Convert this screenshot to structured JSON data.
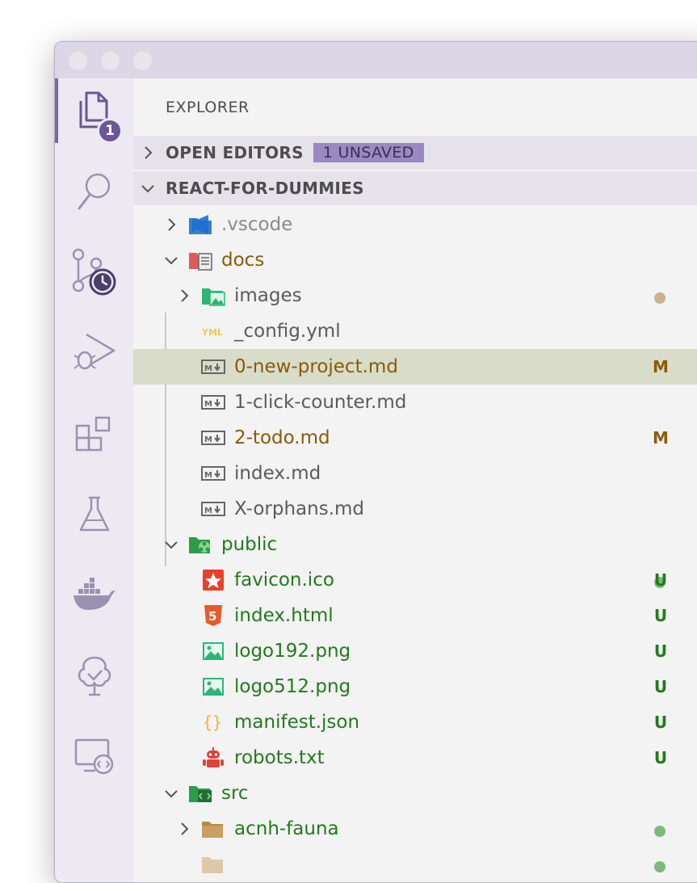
{
  "explorer": {
    "title": "EXPLORER",
    "activity_badge": "1",
    "open_editors": {
      "label": "OPEN EDITORS",
      "badge": "1 UNSAVED"
    },
    "project": {
      "label": "REACT-FOR-DUMMIES"
    }
  },
  "tree": [
    {
      "label": ".vscode",
      "status": "",
      "color": "#8a8a8a",
      "icon": "vscode-folder-icon"
    },
    {
      "label": "docs",
      "status": "dot",
      "color": "#8b5a08",
      "icon": "docs-folder-icon"
    },
    {
      "label": "images",
      "status": "",
      "color": "#5b5b5b",
      "icon": "images-folder-icon"
    },
    {
      "label": "_config.yml",
      "status": "",
      "color": "#5b5b5b",
      "icon": "yaml-icon"
    },
    {
      "label": "0-new-project.md",
      "status": "M",
      "color": "#8b5a08",
      "icon": "markdown-icon"
    },
    {
      "label": "1-click-counter.md",
      "status": "",
      "color": "#5b5b5b",
      "icon": "markdown-icon"
    },
    {
      "label": "2-todo.md",
      "status": "M",
      "color": "#8b5a08",
      "icon": "markdown-icon"
    },
    {
      "label": "index.md",
      "status": "",
      "color": "#5b5b5b",
      "icon": "markdown-icon"
    },
    {
      "label": "X-orphans.md",
      "status": "",
      "color": "#5b5b5b",
      "icon": "markdown-icon"
    },
    {
      "label": "public",
      "status": "dot",
      "color": "#237a1c",
      "icon": "public-folder-icon"
    },
    {
      "label": "favicon.ico",
      "status": "U",
      "color": "#237a1c",
      "icon": "favicon-icon"
    },
    {
      "label": "index.html",
      "status": "U",
      "color": "#237a1c",
      "icon": "html5-icon"
    },
    {
      "label": "logo192.png",
      "status": "U",
      "color": "#237a1c",
      "icon": "image-icon"
    },
    {
      "label": "logo512.png",
      "status": "U",
      "color": "#237a1c",
      "icon": "image-icon"
    },
    {
      "label": "manifest.json",
      "status": "U",
      "color": "#237a1c",
      "icon": "json-icon"
    },
    {
      "label": "robots.txt",
      "status": "U",
      "color": "#237a1c",
      "icon": "robot-icon"
    },
    {
      "label": "src",
      "status": "dot",
      "color": "#237a1c",
      "icon": "src-folder-icon"
    },
    {
      "label": "acnh-fauna",
      "status": "dot",
      "color": "#237a1c",
      "icon": "folder-icon"
    }
  ],
  "colors": {
    "accent": "#6a5698",
    "modified": "#8b5a08",
    "untracked": "#237a1c",
    "modified_dot": "#c9b28a",
    "untracked_dot": "#7cba7c",
    "selection": "#d8dcc9"
  }
}
